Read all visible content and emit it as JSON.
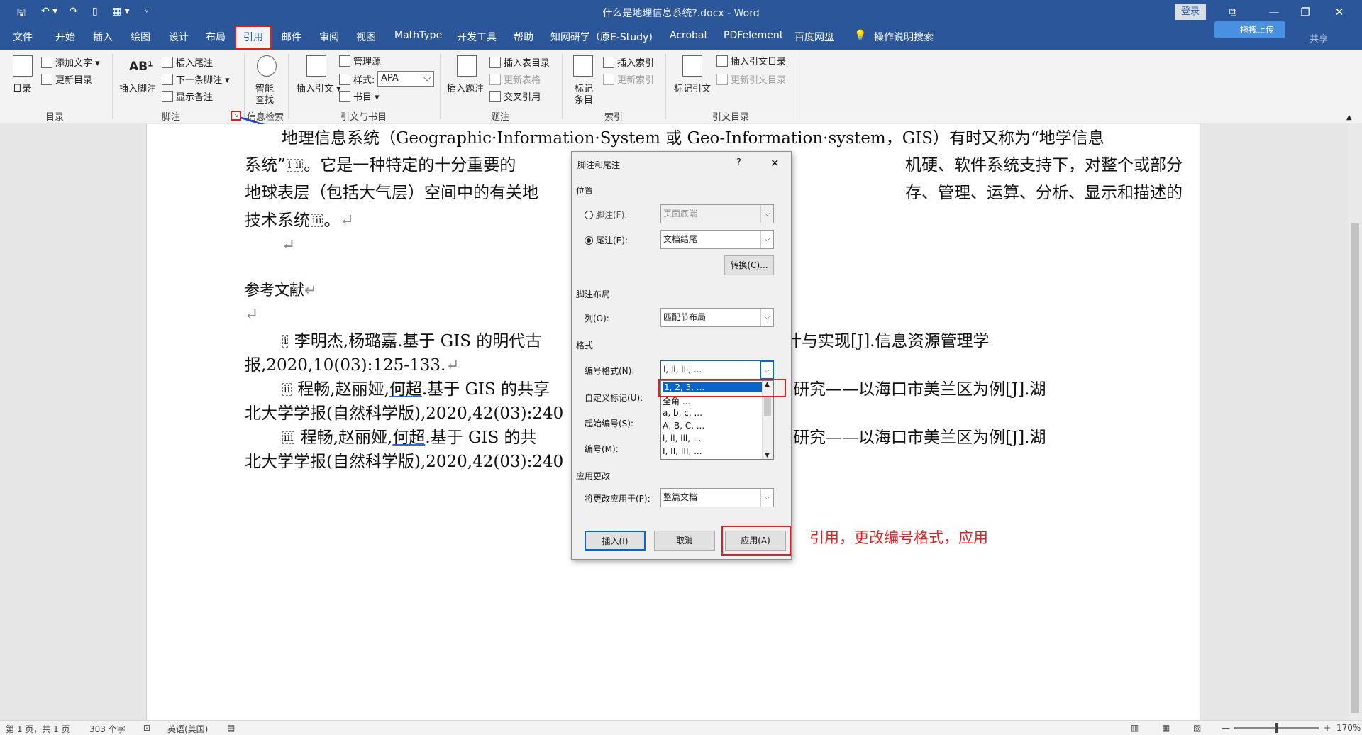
{
  "window": {
    "doc_title": "什么是地理信息系统?.docx  -  Word",
    "login": "登录",
    "upload": "拖拽上传",
    "share": "共享"
  },
  "tabs": [
    "文件",
    "开始",
    "插入",
    "绘图",
    "设计",
    "布局",
    "引用",
    "邮件",
    "审阅",
    "视图",
    "MathType",
    "开发工具",
    "帮助",
    "知网研学（原E-Study)",
    "Acrobat",
    "PDFelement",
    "百度网盘",
    "操作说明搜索"
  ],
  "ribbon": {
    "toc": {
      "big": "目录",
      "add_text": "添加文字",
      "update": "更新目录",
      "group": "目录"
    },
    "footnotes": {
      "big": "插入脚注",
      "endnote": "插入尾注",
      "next": "下一条脚注",
      "show": "显示备注",
      "group": "脚注"
    },
    "research": {
      "big1": "智能",
      "big2": "查找",
      "group": "信息检索"
    },
    "citations": {
      "big": "插入引文",
      "manage": "管理源",
      "style_label": "样式:",
      "style_value": "APA",
      "biblio": "书目",
      "group": "引文与书目"
    },
    "captions": {
      "big": "插入题注",
      "table_figs": "插入表目录",
      "update_table": "更新表格",
      "crossref": "交叉引用",
      "group": "题注"
    },
    "index": {
      "big1": "标记",
      "big2": "条目",
      "insert": "插入索引",
      "update": "更新索引",
      "group": "索引"
    },
    "toa": {
      "big": "标记引文",
      "insert": "插入引文目录",
      "update": "更新引文目录",
      "group": "引文目录"
    }
  },
  "document": {
    "para1_line1": "地理信息系统（Geographic·Information·System 或 Geo-Information·system，GIS）有时又称为“地学信息",
    "para1_line2a": "系统”",
    "para1_line2b": "。它是一种特定的十分重要的",
    "para1_line2c": "机硬、软件系统支持下，对整个或部分",
    "para1_line3a": "地球表层（包括大气层）空间中的有关地",
    "para1_line3b": "存、管理、运算、分析、显示和描述的",
    "para1_line4": "技术系统",
    "para1_line4_end": "。",
    "ref_mark_1": "i",
    "ref_mark_2": "ii",
    "ref_mark_3": "iii",
    "heading": "参考文献",
    "ref1_a": "李明杰,杨璐嘉.基于 GIS 的明代古",
    "ref1_b": "计与实现[J].信息资源管理学",
    "ref1_line2": "报,2020,10(03):125-133.",
    "ref2_a": "程畅,赵丽娅,",
    "ref2_name": "何超",
    "ref2_b": ".基于 GIS 的共享",
    "ref2_c": "展研究——以海口市美兰区为例[J].湖",
    "ref2_line2": "北大学学报(自然科学版),2020,42(03):240",
    "ref3_a": "程畅,赵丽娅,",
    "ref3_name": "何超",
    "ref3_b": ".基于 GIS 的共",
    "ref3_c": "展研究——以海口市美兰区为例[J].湖",
    "ref3_line2": "北大学学报(自然科学版),2020,42(03):240"
  },
  "dialog": {
    "title": "脚注和尾注",
    "help": "?",
    "close": "✕",
    "position_label": "位置",
    "footnote_label": "脚注(F):",
    "footnote_value": "页面底端",
    "endnote_label": "尾注(E):",
    "endnote_value": "文档结尾",
    "convert": "转换(C)...",
    "layout_label": "脚注布局",
    "columns_label": "列(O):",
    "columns_value": "匹配节布局",
    "format_label": "格式",
    "numfmt_label": "编号格式(N):",
    "numfmt_value": "i, ii, iii, ...",
    "custom_label": "自定义标记(U):",
    "start_label": "起始编号(S):",
    "numbering_label": "编号(M):",
    "list_options": [
      "1, 2, 3, ...",
      "全角 ...",
      "a, b, c, ...",
      "A, B, C, ...",
      "i, ii, iii, ...",
      "I, II, III, ..."
    ],
    "apply_section": "应用更改",
    "apply_to_label": "将更改应用于(P):",
    "apply_to_value": "整篇文档",
    "insert": "插入(I)",
    "cancel": "取消",
    "apply": "应用(A)"
  },
  "annotation": "引用，更改编号格式，应用",
  "status": {
    "page": "第 1 页，共 1 页",
    "words": "303 个字",
    "lang": "英语(美国)",
    "zoom": "170%"
  }
}
